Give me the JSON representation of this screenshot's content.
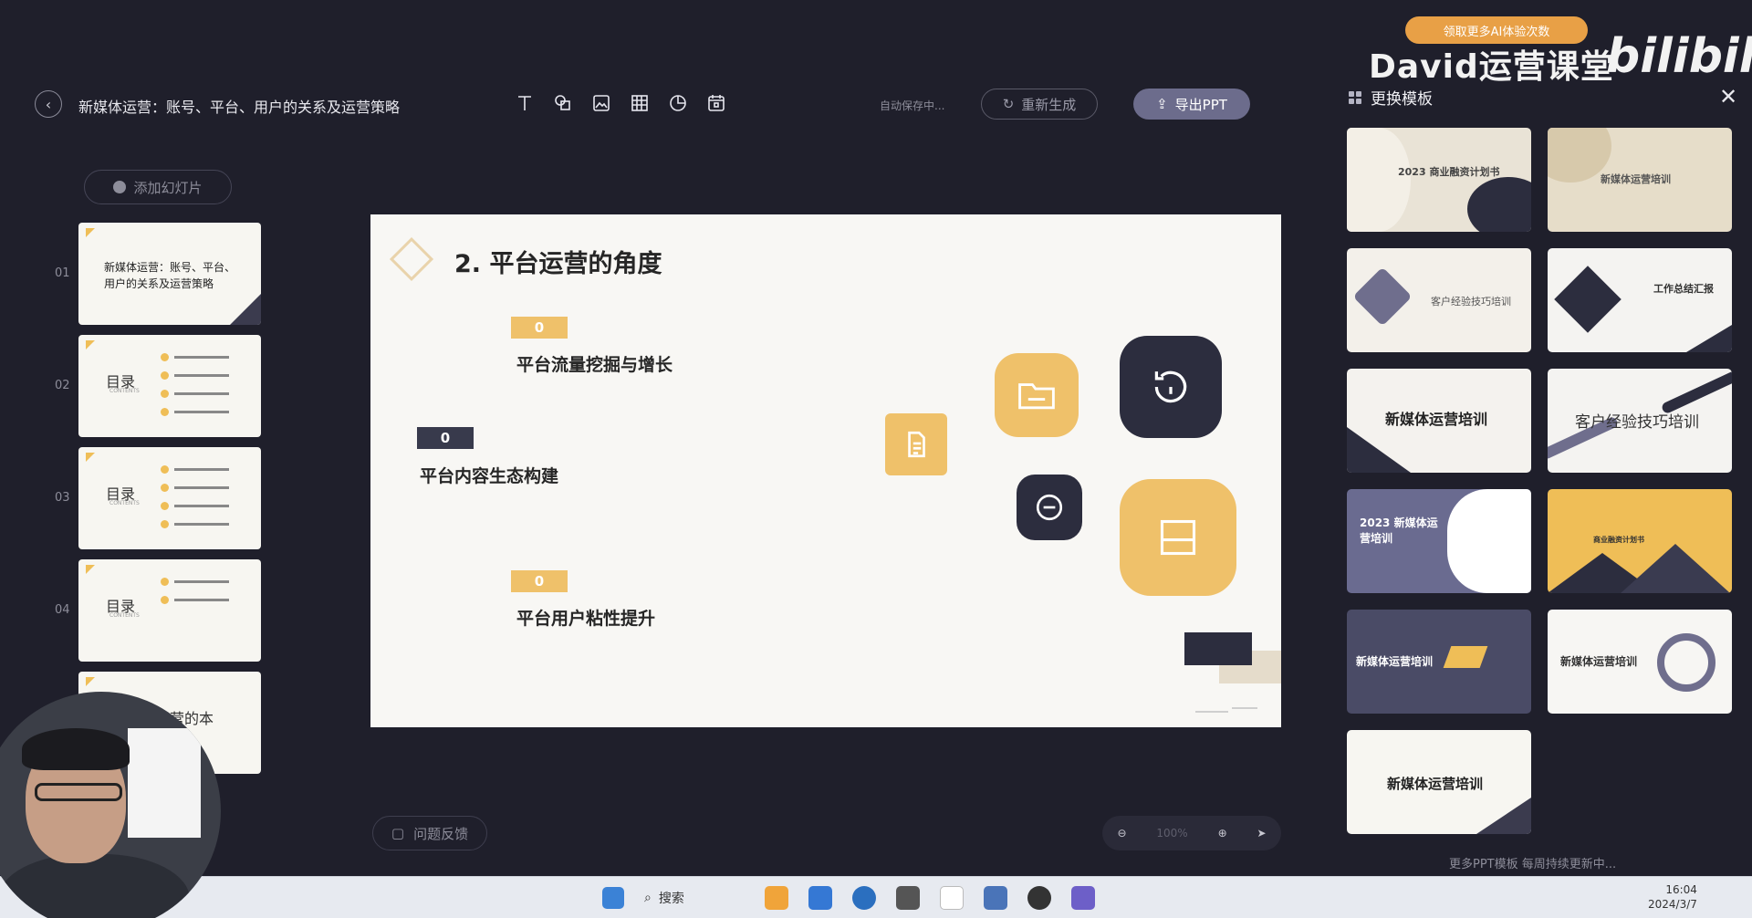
{
  "header": {
    "doc_title": "新媒体运营：账号、平台、用户的关系及运营策略",
    "autosave": "自动保存中...",
    "regenerate_label": "重新生成",
    "export_label": "导出PPT",
    "tools": [
      "text-tool-icon",
      "shape-tool-icon",
      "image-tool-icon",
      "table-tool-icon",
      "chart-tool-icon",
      "calendar-tool-icon"
    ]
  },
  "sidebar": {
    "add_slide_label": "添加幻灯片",
    "slides": [
      {
        "num": "01",
        "title": "新媒体运营：账号、平台、用户的关系及运营策略"
      },
      {
        "num": "02",
        "title": "目录",
        "sub": "CONTENTS"
      },
      {
        "num": "03",
        "title": "目录",
        "sub": "CONTENTS"
      },
      {
        "num": "04",
        "title": "目录",
        "sub": "CONTENTS"
      },
      {
        "num": "05",
        "title": "营的本"
      }
    ]
  },
  "slide": {
    "heading": "2. 平台运营的角度",
    "points": [
      {
        "tag": "0",
        "text": "平台流量挖掘与增长"
      },
      {
        "tag": "0",
        "text": "平台内容生态构建"
      },
      {
        "tag": "0",
        "text": "平台用户粘性提升"
      }
    ]
  },
  "footer": {
    "feedback_label": "问题反馈",
    "zoom_level": "100%"
  },
  "templates": {
    "panel_title": "更换模板",
    "promo": "领取更多AI体验次数",
    "brand": "David运营课堂",
    "brand2": "bilibili",
    "items": [
      {
        "title": "2023 商业融资计划书"
      },
      {
        "title": "新媒体运营培训"
      },
      {
        "title": "客户经验技巧培训"
      },
      {
        "title": "工作总结汇报"
      },
      {
        "title": "新媒体运营培训"
      },
      {
        "title": "客户经验技巧培训"
      },
      {
        "title": "2023 新媒体运营培训"
      },
      {
        "title": "商业融资计划书"
      },
      {
        "title": "新媒体运营培训"
      },
      {
        "title": "新媒体运营培训"
      },
      {
        "title": "新媒体运营培训"
      }
    ],
    "footer": "更多PPT模板 每周持续更新中..."
  },
  "taskbar": {
    "search_label": "搜索",
    "time": "16:04",
    "date": "2024/3/7"
  },
  "colors": {
    "background": "#1f1f2b",
    "accent_yellow": "#efc16a",
    "accent_dark": "#383a4c",
    "export_button": "#6c6c8c"
  }
}
